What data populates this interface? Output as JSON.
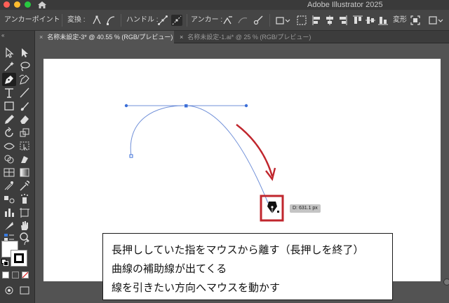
{
  "window": {
    "app_title": "Adobe Illustrator 2025"
  },
  "control_bar": {
    "tool_name": "アンカーポイント",
    "convert_label": "変換 :",
    "handle_label": "ハンドル :",
    "anchor_label": "アンカー :",
    "transform_label": "変形"
  },
  "tabs": [
    {
      "label": "名称未設定-3* @ 40.55 % (RGB/プレビュー)",
      "close": "×",
      "active": true
    },
    {
      "label": "名称未設定-1.ai* @ 25 % (RGB/プレビュー)",
      "close": "×",
      "active": false
    }
  ],
  "toolbar": {
    "collapse_glyph": "«",
    "active_tool": "pen-tool"
  },
  "canvas": {
    "distance_readout": "D: 631.1 px",
    "path_color": "#6f8fd8",
    "anchor_color": "#3b6fd8",
    "arrow_color": "#c0262d",
    "highlight_box_color": "#c0262d"
  },
  "caption": {
    "lines": [
      "長押ししていた指をマウスから離す（長押しを終了）",
      "曲線の補助線が出てくる",
      "線を引きたい方向へマウスを動かす"
    ]
  }
}
